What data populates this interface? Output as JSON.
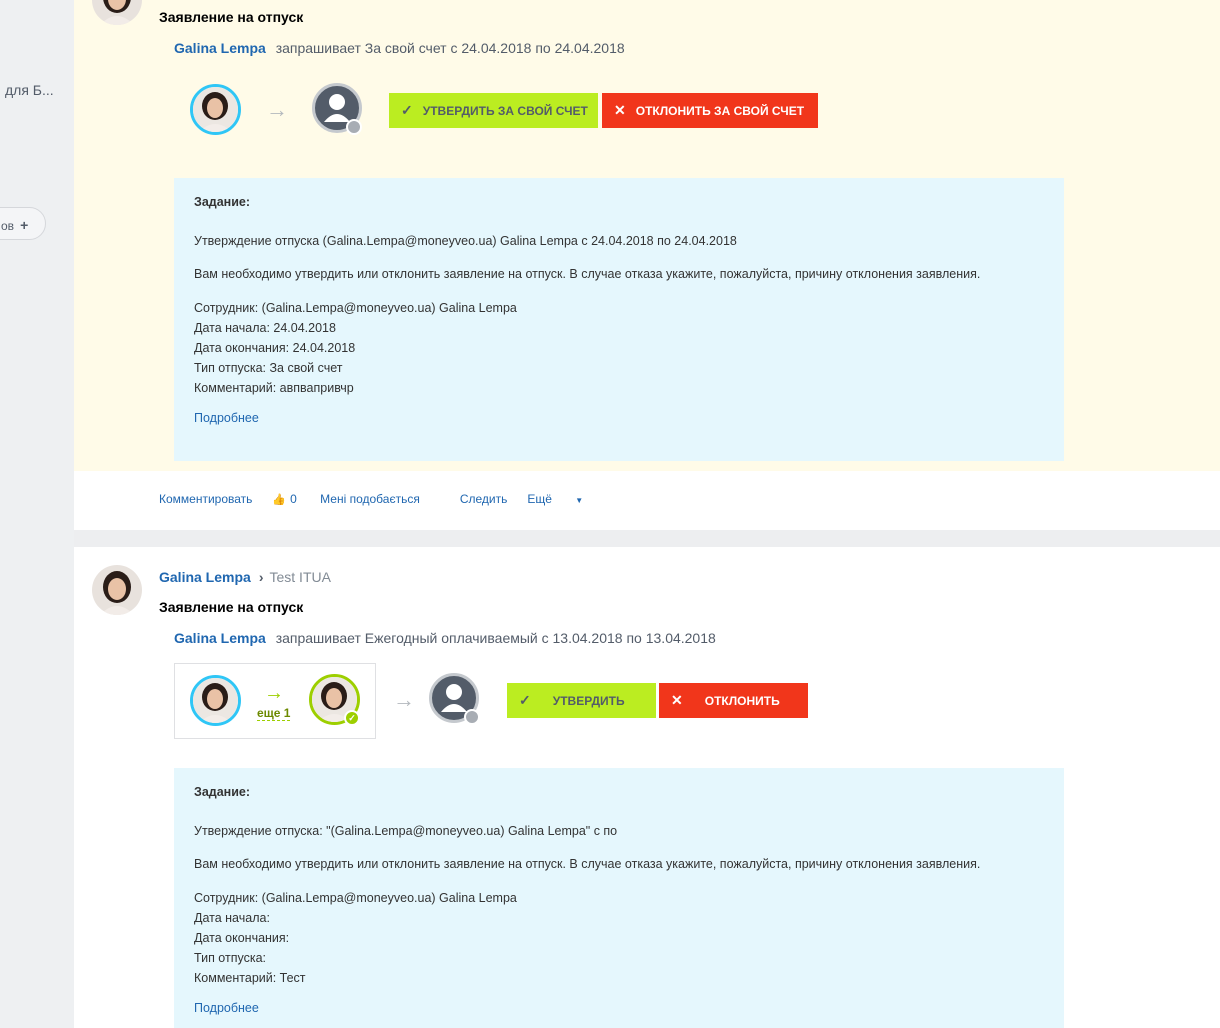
{
  "sidebar": {
    "truncated_text": "для Б...",
    "pill_label": "ов",
    "pill_icon": "plus-icon"
  },
  "post1": {
    "title": "Заявление на отпуск",
    "request": {
      "author": "Galina Lempa",
      "text": "запрашивает За свой счет с 24.04.2018 по 24.04.2018"
    },
    "approve_button": "Утвердить за свой счет",
    "decline_button": "Отклонить за свой счет",
    "task": {
      "heading": "Задание:",
      "approval_line": "Утверждение отпуска (Galina.Lempa@moneyveo.ua) Galina Lempa с 24.04.2018 по 24.04.2018",
      "instruction": "Вам необходимо утвердить или отклонить заявление на отпуск. В случае отказа укажите, пожалуйста, причину отклонения заявления.",
      "employee": "Сотрудник: (Galina.Lempa@moneyveo.ua) Galina Lempa",
      "start_date": "Дата начала: 24.04.2018",
      "end_date": "Дата окончания: 24.04.2018",
      "leave_type": "Тип отпуска: За свой счет",
      "comment": "Комментарий: авпвапривчр",
      "more_link": "Подробнее"
    },
    "footer": {
      "comment": "Комментировать",
      "likes_count": "0",
      "likes_label": "Мені подобається",
      "follow": "Следить",
      "more": "Ещё"
    }
  },
  "post2": {
    "author": "Galina Lempa",
    "destination": "Test ITUA",
    "title": "Заявление на отпуск",
    "request": {
      "author": "Galina Lempa",
      "text": "запрашивает Ежегодный оплачиваемый с 13.04.2018 по 13.04.2018"
    },
    "more_approvers": "еще 1",
    "approve_button": "Утвердить",
    "decline_button": "Отклонить",
    "task": {
      "heading": "Задание:",
      "approval_line": "Утверждение отпуска: \"(Galina.Lempa@moneyveo.ua) Galina Lempa\" с по",
      "instruction": "Вам необходимо утвердить или отклонить заявление на отпуск. В случае отказа укажите, пожалуйста, причину отклонения заявления.",
      "employee": "Сотрудник: (Galina.Lempa@moneyveo.ua) Galina Lempa",
      "start_date": "Дата начала:",
      "end_date": "Дата окончания:",
      "leave_type": "Тип отпуска:",
      "comment": "Комментарий: Тест",
      "more_link": "Подробнее"
    }
  },
  "colors": {
    "approve": "#bbed21",
    "decline": "#f1361b",
    "link": "#2067b0",
    "task_bg": "#e5f7fd",
    "highlight_bg": "#fffbe8"
  }
}
